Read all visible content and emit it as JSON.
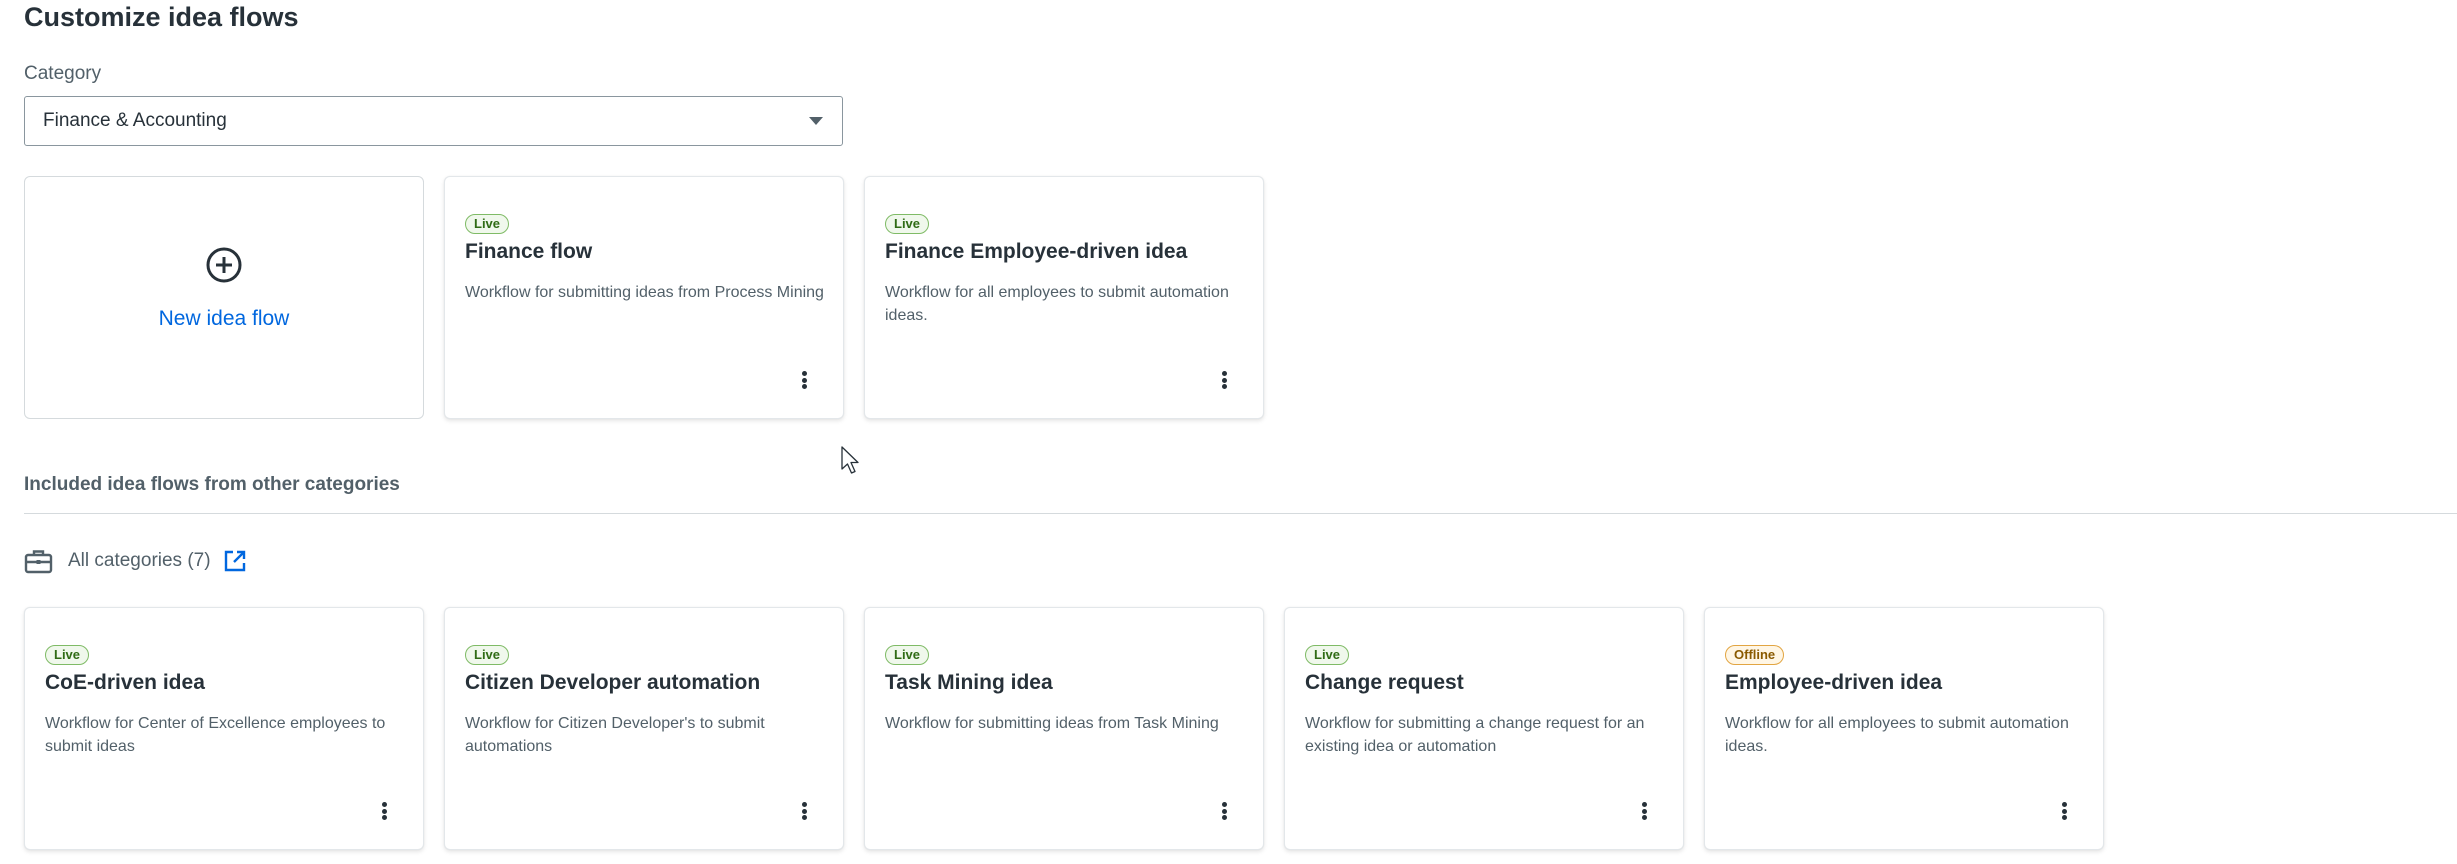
{
  "page": {
    "title": "Customize idea flows"
  },
  "category": {
    "label": "Category",
    "selected": "Finance & Accounting"
  },
  "new_flow": {
    "label": "New idea flow",
    "icon": "plus-circle-icon"
  },
  "category_flows": [
    {
      "status": "Live",
      "title": "Finance flow",
      "description": "Workflow for submitting ideas from Process Mining"
    },
    {
      "status": "Live",
      "title": "Finance Employee-driven idea",
      "description": "Workflow for all employees to submit automation ideas."
    }
  ],
  "included": {
    "section_title": "Included idea flows from other categories",
    "all_categories_label": "All categories (7)",
    "icon": "briefcase-icon",
    "link_icon": "external-link-icon",
    "flows": [
      {
        "status": "Live",
        "title": "CoE-driven idea",
        "description": "Workflow for Center of Excellence employees to submit ideas"
      },
      {
        "status": "Live",
        "title": "Citizen Developer automation",
        "description": "Workflow for Citizen Developer's to submit automations"
      },
      {
        "status": "Live",
        "title": "Task Mining idea",
        "description": "Workflow for submitting ideas from Task Mining"
      },
      {
        "status": "Live",
        "title": "Change request",
        "description": "Workflow for submitting a change request for an existing idea or automation"
      },
      {
        "status": "Offline",
        "title": "Employee-driven idea",
        "description": "Workflow for all employees to submit automation ideas."
      }
    ]
  },
  "colors": {
    "accent": "#0067df",
    "live": "#2f6b15",
    "offline": "#8a5a00",
    "text": "#273139",
    "muted": "#526069"
  }
}
